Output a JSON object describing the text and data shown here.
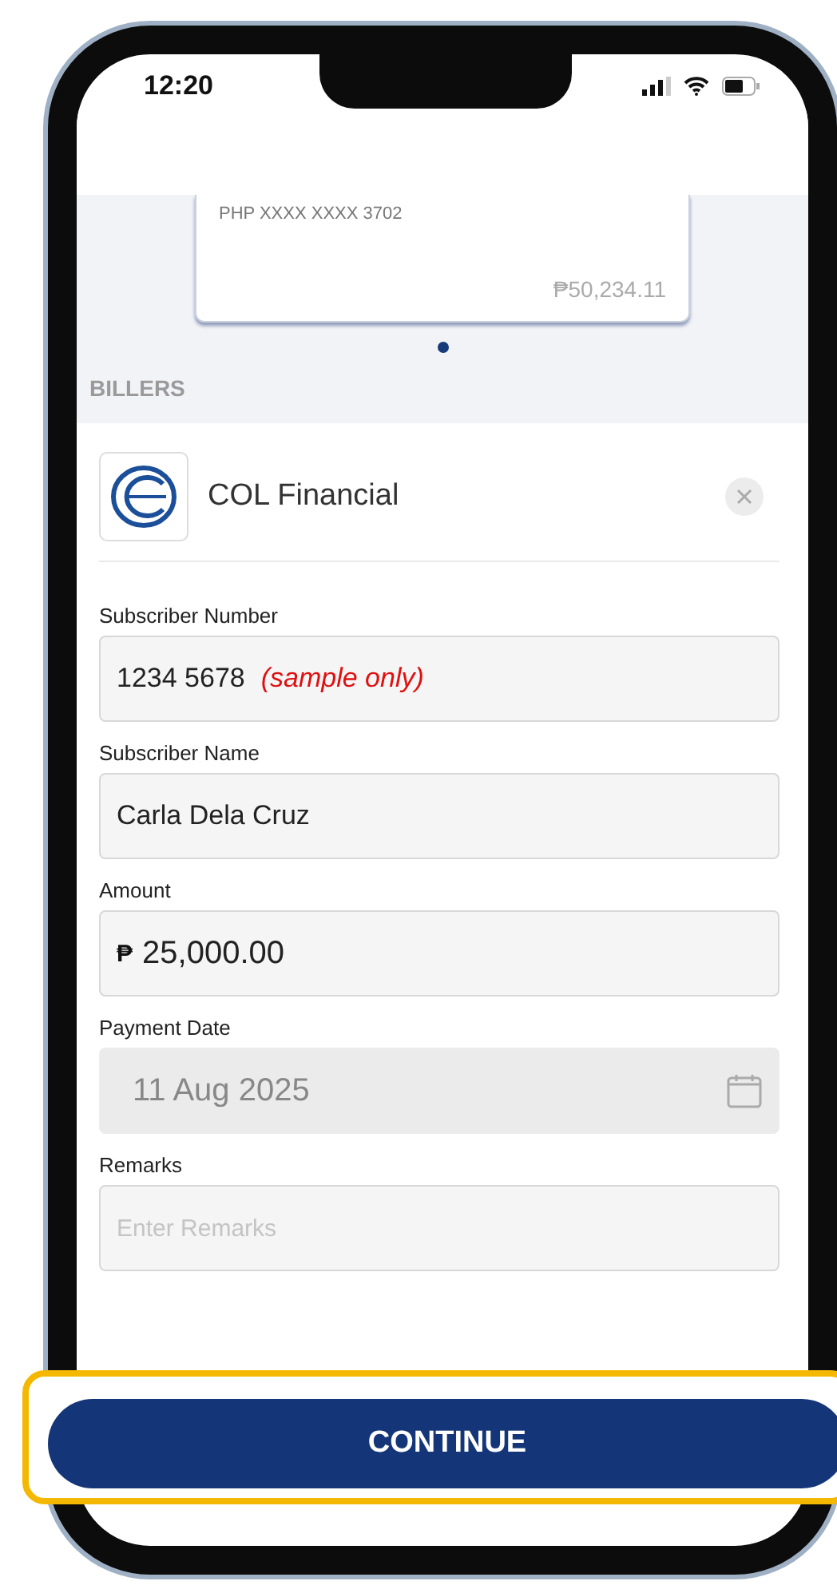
{
  "status_bar": {
    "time": "12:20"
  },
  "account_card": {
    "masked_number": "PHP XXXX XXXX 3702",
    "balance": "₱50,234.11"
  },
  "carousel_dots": [
    {
      "selected": true
    }
  ],
  "section_title": "BILLERS",
  "biller": {
    "name": "COL Financial"
  },
  "fields": [
    {
      "kind": "text",
      "label": "Subscriber Number",
      "value": "1234 5678",
      "annotation": "(sample only)",
      "disabled": false
    },
    {
      "kind": "text",
      "label": "Subscriber Name",
      "value": "Carla Dela Cruz",
      "disabled": false
    },
    {
      "kind": "amount",
      "label": "Amount",
      "prefix": "₱",
      "value": "25,000.00",
      "disabled": false
    },
    {
      "kind": "date",
      "label": "Payment Date",
      "value": "11 Aug 2025",
      "disabled": true
    },
    {
      "kind": "text",
      "label": "Remarks",
      "placeholder": "Enter Remarks",
      "disabled": false
    }
  ],
  "continue_button": {
    "label": "CONTINUE",
    "highlighted": true
  }
}
